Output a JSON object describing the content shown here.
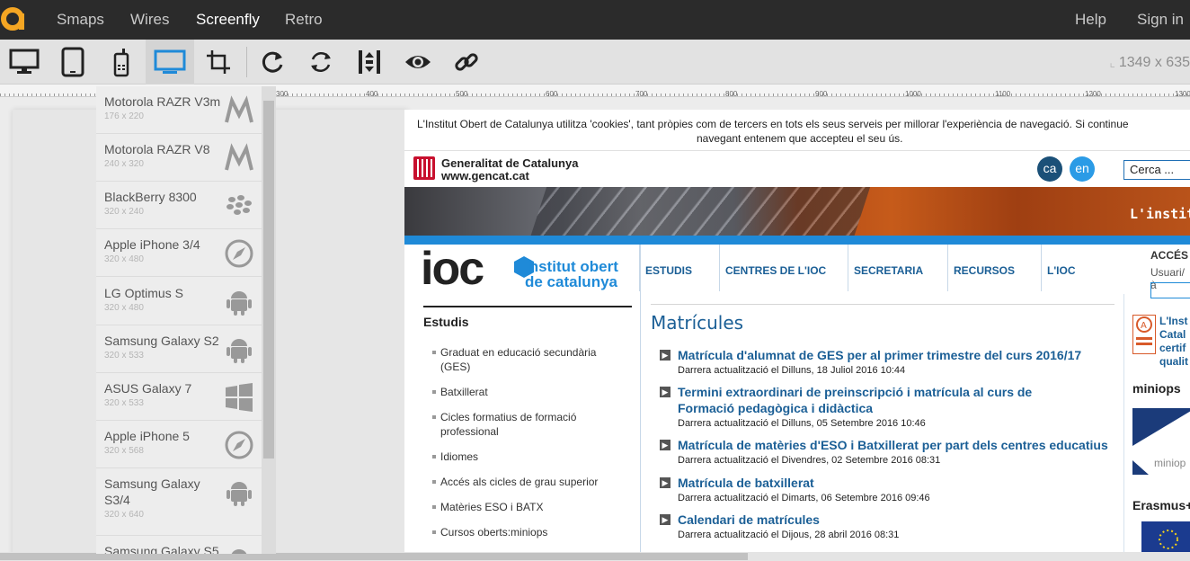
{
  "topnav": {
    "links": [
      {
        "label": "Smaps"
      },
      {
        "label": "Wires"
      },
      {
        "label": "Screenfly"
      },
      {
        "label": "Retro"
      }
    ],
    "help": "Help",
    "signin": "Sign in"
  },
  "toolbar": {
    "buttons": [
      "desktop-icon",
      "tablet-icon",
      "mobile-icon",
      "television-icon",
      "custom-size-icon",
      "rotate-icon",
      "sync-scroll-icon",
      "scroll-toggle-icon",
      "preview-eye-icon",
      "share-link-icon"
    ],
    "active": "television-icon",
    "dimensions": "1349 x 635"
  },
  "ruler": {
    "labels": [
      "300",
      "400",
      "500",
      "600",
      "700",
      "800",
      "900",
      "1000",
      "1100",
      "1200",
      "1300"
    ]
  },
  "devices": [
    {
      "name": "Motorola RAZR V3m",
      "size": "176 x 220",
      "icon": "motorola-icon"
    },
    {
      "name": "Motorola RAZR V8",
      "size": "240 x 320",
      "icon": "motorola-icon"
    },
    {
      "name": "BlackBerry 8300",
      "size": "320 x 240",
      "icon": "blackberry-icon"
    },
    {
      "name": "Apple iPhone 3/4",
      "size": "320 x 480",
      "icon": "safari-compass-icon"
    },
    {
      "name": "LG Optimus S",
      "size": "320 x 480",
      "icon": "android-icon"
    },
    {
      "name": "Samsung Galaxy S2",
      "size": "320 x 533",
      "icon": "android-icon"
    },
    {
      "name": "ASUS Galaxy 7",
      "size": "320 x 533",
      "icon": "windows-icon"
    },
    {
      "name": "Apple iPhone 5",
      "size": "320 x 568",
      "icon": "safari-compass-icon"
    },
    {
      "name": "Samsung Galaxy S3/4",
      "size": "320 x 640",
      "icon": "android-icon"
    },
    {
      "name": "Samsung Galaxy S5",
      "size": "",
      "icon": "android-icon"
    }
  ],
  "site": {
    "cookie_line1": "L'Institut Obert de Catalunya utilitza 'cookies', tant pròpies com de tercers en tots els seus serveis per millorar l'experiència de navegació. Si continue",
    "cookie_line2": "navegant entenem que accepteu el seu ús.",
    "gencat_name": "Generalitat de Catalunya",
    "gencat_url": "www.gencat.cat",
    "lang_ca": "ca",
    "lang_en": "en",
    "search_placeholder": "Cerca ...",
    "banner_title": "L'institu",
    "logo_ioc": "ioc",
    "logo_line1": "institut obert",
    "logo_line2": "de catalunya",
    "nav": [
      "ESTUDIS",
      "CENTRES DE L'IOC",
      "SECRETARIA",
      "RECURSOS",
      "L'IOC"
    ],
    "acces": "ACCÉS",
    "usuari": "Usuari/à",
    "left_header": "Estudis",
    "left_items": [
      "Graduat en educació secundària (GES)",
      "Batxillerat",
      "Cicles formatius de formació professional",
      "Idiomes",
      "Accés als cicles de grau superior",
      "Matèries ESO i BATX",
      "Cursos oberts:miniops"
    ],
    "center_header": "Matrícules",
    "news": [
      {
        "title": "Matrícula d'alumnat de GES per al primer trimestre del curs 2016/17",
        "date": "Darrera actualització el Dilluns, 18 Juliol 2016 10:44"
      },
      {
        "title": "Termini extraordinari de preinscripció i matrícula al curs de Formació pedagògica i didàctica",
        "date": "Darrera actualització el Dilluns, 05 Setembre 2016 10:46"
      },
      {
        "title": "Matrícula de matèries d'ESO i Batxillerat per part dels centres educatius",
        "date": "Darrera actualització el Divendres, 02 Setembre 2016 08:31"
      },
      {
        "title": "Matrícula de batxillerat",
        "date": "Darrera actualització el Dimarts, 06 Setembre 2016 09:46"
      },
      {
        "title": "Calendari de matrícules",
        "date": "Darrera actualització el Dijous, 28 abril 2016 08:31"
      }
    ],
    "right_quality": [
      "L'Inst",
      "Catal",
      "certif",
      "qualit"
    ],
    "right_miniops": "miniops",
    "right_miniops_logo": "miniop",
    "right_erasmus": "Erasmus+"
  },
  "colors": {
    "topnav_bg": "#2b2b2b",
    "accent": "#1f8ad8",
    "brand_orange": "#f5a623",
    "link_blue": "#1b5f96"
  }
}
